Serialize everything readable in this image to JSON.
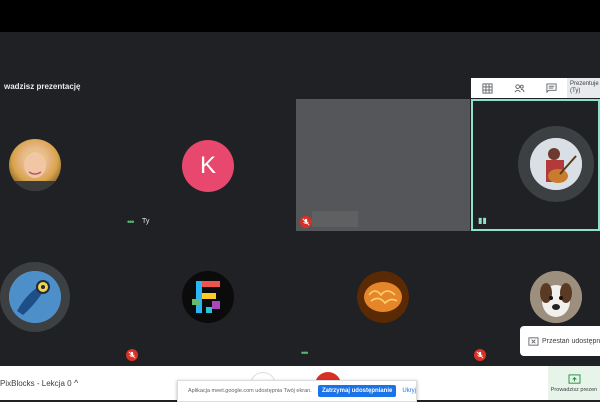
{
  "presentation_label": "wadzisz prezentację",
  "top_controls": {
    "presenting_line1": "Prezentuje",
    "presenting_line2": "(Ty)"
  },
  "self_label": "Ty",
  "participants": [
    {
      "name_icon": "person-photo-avatar"
    },
    {
      "initial": "K",
      "color": "#e8486d"
    },
    {
      "name_icon": "video-feed"
    },
    {
      "name_icon": "guitar-player-avatar"
    },
    {
      "name_icon": "blue-emblem-avatar"
    },
    {
      "name_icon": "pixel-logo-avatar"
    },
    {
      "name_icon": "brain-avatar"
    },
    {
      "name_icon": "dog-avatar"
    }
  ],
  "stop_popup": {
    "label": "Przestań udostępn"
  },
  "bottom_bar": {
    "meeting_title": "PixBlocks - Lekcja 0",
    "share_text": "Aplikacja meet.google.com udostępnia Twój ekran.",
    "stop_sharing": "Zatrzymaj udostępnianie",
    "hide": "Ukryj",
    "present_label": "Prowadzisz prezen"
  },
  "colors": {
    "accent": "#1a73e8",
    "active_border": "#8ee2c8",
    "mic_off": "#d93025"
  }
}
